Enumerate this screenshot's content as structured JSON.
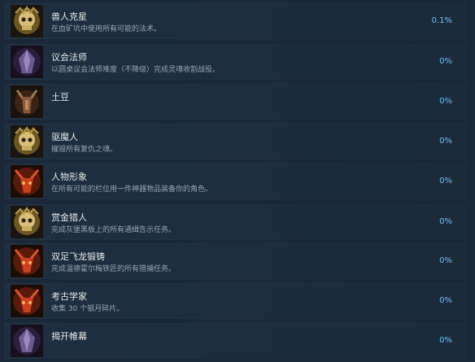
{
  "achievements": [
    {
      "title": "兽人克星",
      "desc": "在血矿坑中使用所有可能的法术。",
      "percent": "0.1%",
      "icon": "gold-skull-icon"
    },
    {
      "title": "议会法师",
      "desc": "以圆桌议会法师难度（不降级）完成灵魂收割战役。",
      "percent": "0%",
      "icon": "purple-crystal-icon"
    },
    {
      "title": "土豆",
      "desc": "",
      "percent": "0%",
      "icon": "horned-demon-icon"
    },
    {
      "title": "驱魔人",
      "desc": "摧毁所有复仇之魂。",
      "percent": "0%",
      "icon": "gold-skull-icon"
    },
    {
      "title": "人物形象",
      "desc": "在所有可能的栏位用一件神器物品装备你的角色。",
      "percent": "0%",
      "icon": "red-demon-icon"
    },
    {
      "title": "赏金猎人",
      "desc": "完成灰堡黑板上的所有通缉告示任务。",
      "percent": "0%",
      "icon": "gold-skull-icon"
    },
    {
      "title": "双足飞龙锻铸",
      "desc": "完成温德霍尔梅铁匠的所有猎捕任务。",
      "percent": "0%",
      "icon": "red-demon-icon"
    },
    {
      "title": "考古学家",
      "desc": "收集 30 个银月碎片。",
      "percent": "0%",
      "icon": "red-demon-icon"
    },
    {
      "title": "揭开帷幕",
      "desc": "",
      "percent": "0%",
      "icon": "purple-crystal-icon"
    }
  ]
}
